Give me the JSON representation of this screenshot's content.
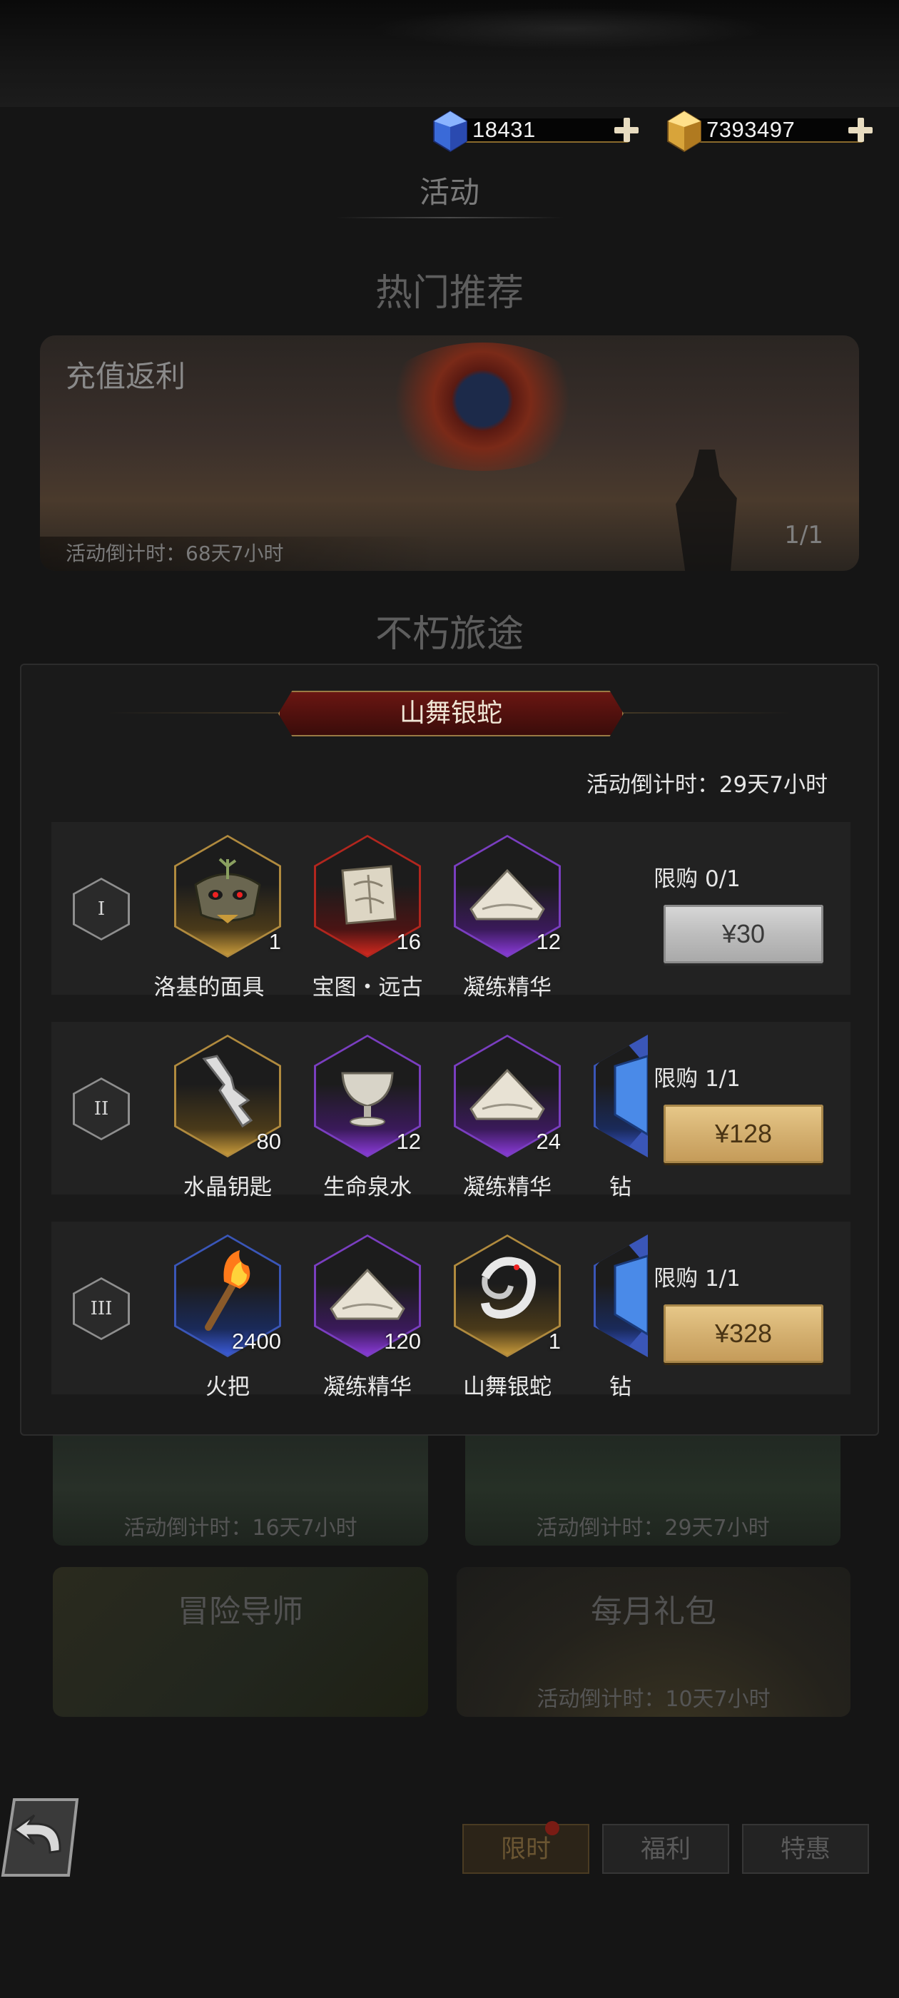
{
  "header": {
    "currencies": [
      {
        "icon": "blue-diamond-icon",
        "value": "18431"
      },
      {
        "icon": "gold-gem-icon",
        "value": "7393497"
      }
    ]
  },
  "page_title": "活动",
  "sections": {
    "hot": "热门推荐",
    "immortal": "不朽旅途"
  },
  "banner": {
    "label": "充值返利",
    "countdown": "活动倒计时：68天7小时",
    "pager": "1/1"
  },
  "modal": {
    "title": "山舞银蛇",
    "countdown": "活动倒计时：29天7小时",
    "tiers": [
      {
        "roman": "I",
        "limit": "限购 0/1",
        "price": "¥30",
        "purchased": true,
        "items": [
          {
            "name": "洛基的面具",
            "qty": "1",
            "rarity": "gold",
            "icon": "mask-icon"
          },
          {
            "name": "宝图・远古",
            "qty": "16",
            "rarity": "red",
            "icon": "treasure-map-icon"
          },
          {
            "name": "凝练精华",
            "qty": "12",
            "rarity": "purple",
            "icon": "essence-pile-icon"
          }
        ]
      },
      {
        "roman": "II",
        "limit": "限购 1/1",
        "price": "¥128",
        "purchased": false,
        "items": [
          {
            "name": "水晶钥匙",
            "qty": "80",
            "rarity": "gold",
            "icon": "crystal-key-icon"
          },
          {
            "name": "生命泉水",
            "qty": "12",
            "rarity": "purple",
            "icon": "chalice-icon"
          },
          {
            "name": "凝练精华",
            "qty": "24",
            "rarity": "purple",
            "icon": "essence-pile-icon"
          },
          {
            "name": "钻",
            "qty": "",
            "rarity": "blue",
            "icon": "diamond-icon"
          }
        ]
      },
      {
        "roman": "III",
        "limit": "限购 1/1",
        "price": "¥328",
        "purchased": false,
        "items": [
          {
            "name": "火把",
            "qty": "2400",
            "rarity": "blue",
            "icon": "torch-icon"
          },
          {
            "name": "凝练精华",
            "qty": "120",
            "rarity": "purple",
            "icon": "essence-pile-icon"
          },
          {
            "name": "山舞银蛇",
            "qty": "1",
            "rarity": "gold",
            "icon": "silver-serpent-icon"
          },
          {
            "name": "钻",
            "qty": "",
            "rarity": "blue",
            "icon": "diamond-icon"
          }
        ]
      }
    ]
  },
  "activity_cards": [
    {
      "title": "",
      "countdown": "活动倒计时：16天7小时"
    },
    {
      "title": "",
      "countdown": "活动倒计时：29天7小时"
    },
    {
      "title": "冒险导师",
      "countdown": ""
    },
    {
      "title": "每月礼包",
      "countdown": "活动倒计时：10天7小时"
    }
  ],
  "bottom_tabs": [
    {
      "label": "限时",
      "active": true
    },
    {
      "label": "福利",
      "active": false
    },
    {
      "label": "特惠",
      "active": false
    }
  ],
  "colors": {
    "accent_gold": "#c89a3a",
    "modal_title_red": "#6a1612",
    "rarity_gold": "#b08a3e",
    "rarity_red": "#b2261e",
    "rarity_purple": "#7a3ec0",
    "rarity_blue": "#3a56b8"
  }
}
